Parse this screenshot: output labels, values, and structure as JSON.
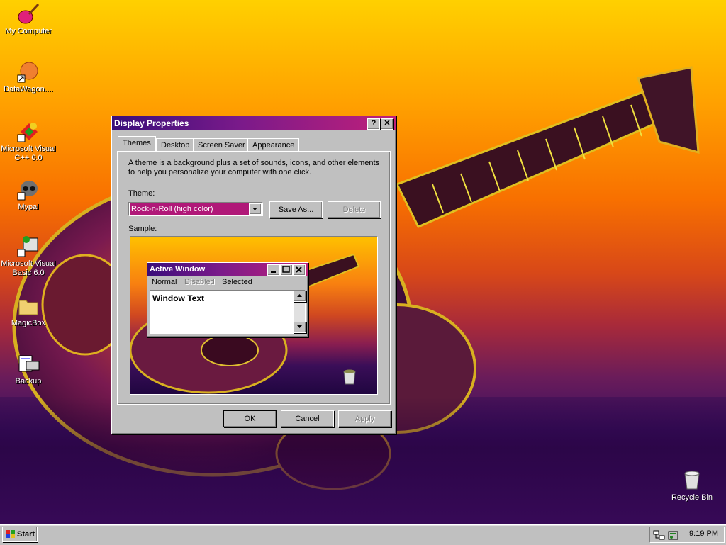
{
  "desktop": {
    "icons": [
      {
        "label": "My Computer"
      },
      {
        "label": "DataWagon...."
      },
      {
        "label": "Microsoft Visual C++ 6.0"
      },
      {
        "label": "Mypal"
      },
      {
        "label": "Microsoft Visual Basic 6.0"
      },
      {
        "label": "MagicBox"
      },
      {
        "label": "Backup"
      },
      {
        "label": "Recycle Bin"
      }
    ]
  },
  "dialog": {
    "title": "Display Properties",
    "help_btn": "?",
    "close_btn": "✕",
    "tabs": [
      {
        "label": "Themes"
      },
      {
        "label": "Desktop"
      },
      {
        "label": "Screen Saver"
      },
      {
        "label": "Appearance"
      }
    ],
    "description": "A theme is a background plus a set of sounds, icons, and other elements to help you personalize your computer with one click.",
    "theme_label": "Theme:",
    "theme_value": "Rock-n-Roll (high color)",
    "save_as_label": "Save As...",
    "delete_label": "Delete",
    "sample_label": "Sample:",
    "preview": {
      "title": "Active Window",
      "menu": {
        "normal": "Normal",
        "disabled": "Disabled",
        "selected": "Selected"
      },
      "text": "Window Text"
    },
    "ok_label": "OK",
    "cancel_label": "Cancel",
    "apply_label": "Apply"
  },
  "taskbar": {
    "start_label": "Start",
    "clock": "9:19 PM"
  },
  "colors": {
    "title_gradient_start": "#3a0e7a",
    "title_gradient_end": "#c0207a",
    "selection": "#b01878"
  }
}
